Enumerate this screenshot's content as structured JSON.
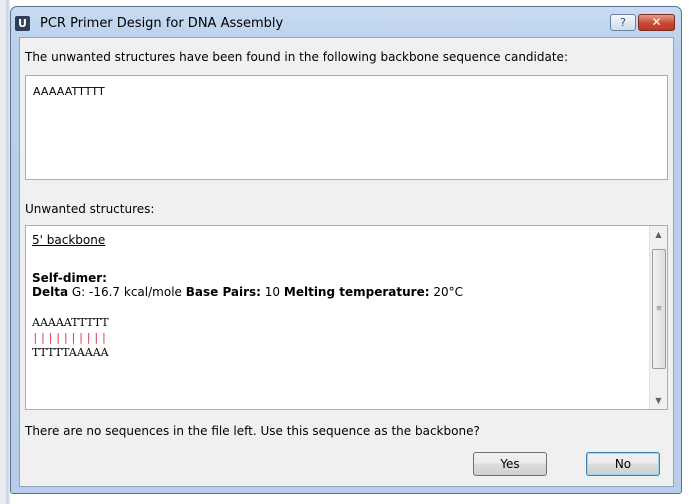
{
  "window": {
    "title": "PCR Primer Design for DNA Assembly",
    "app_icon_letter": "U",
    "help_label": "?",
    "close_label": "✕"
  },
  "candidate": {
    "intro": "The unwanted structures have been found in the following backbone sequence candidate:",
    "sequence": "AAAAATTTTT"
  },
  "structures": {
    "heading": "Unwanted structures:",
    "link": "5' backbone",
    "type": "Self-dimer:",
    "delta_label": "Delta",
    "delta_value": " G: -16.7 kcal/mole ",
    "bp_label": "Base Pairs:",
    "bp_value": " 10 ",
    "tm_label": "Melting temperature:",
    "tm_value": " 20°C",
    "seq_top": "AAAAATTTTT",
    "bonds": "||||||||||",
    "seq_bottom": "TTTTTAAAAA"
  },
  "prompt": {
    "question": "There are no sequences in the file left. Use this sequence as the backbone?",
    "yes_label": "Yes",
    "no_label": "No"
  },
  "icons": {
    "app": "app-logo-icon",
    "help": "help-icon",
    "close": "close-icon",
    "scroll_up": "arrow-up-icon",
    "scroll_down": "arrow-down-icon"
  }
}
